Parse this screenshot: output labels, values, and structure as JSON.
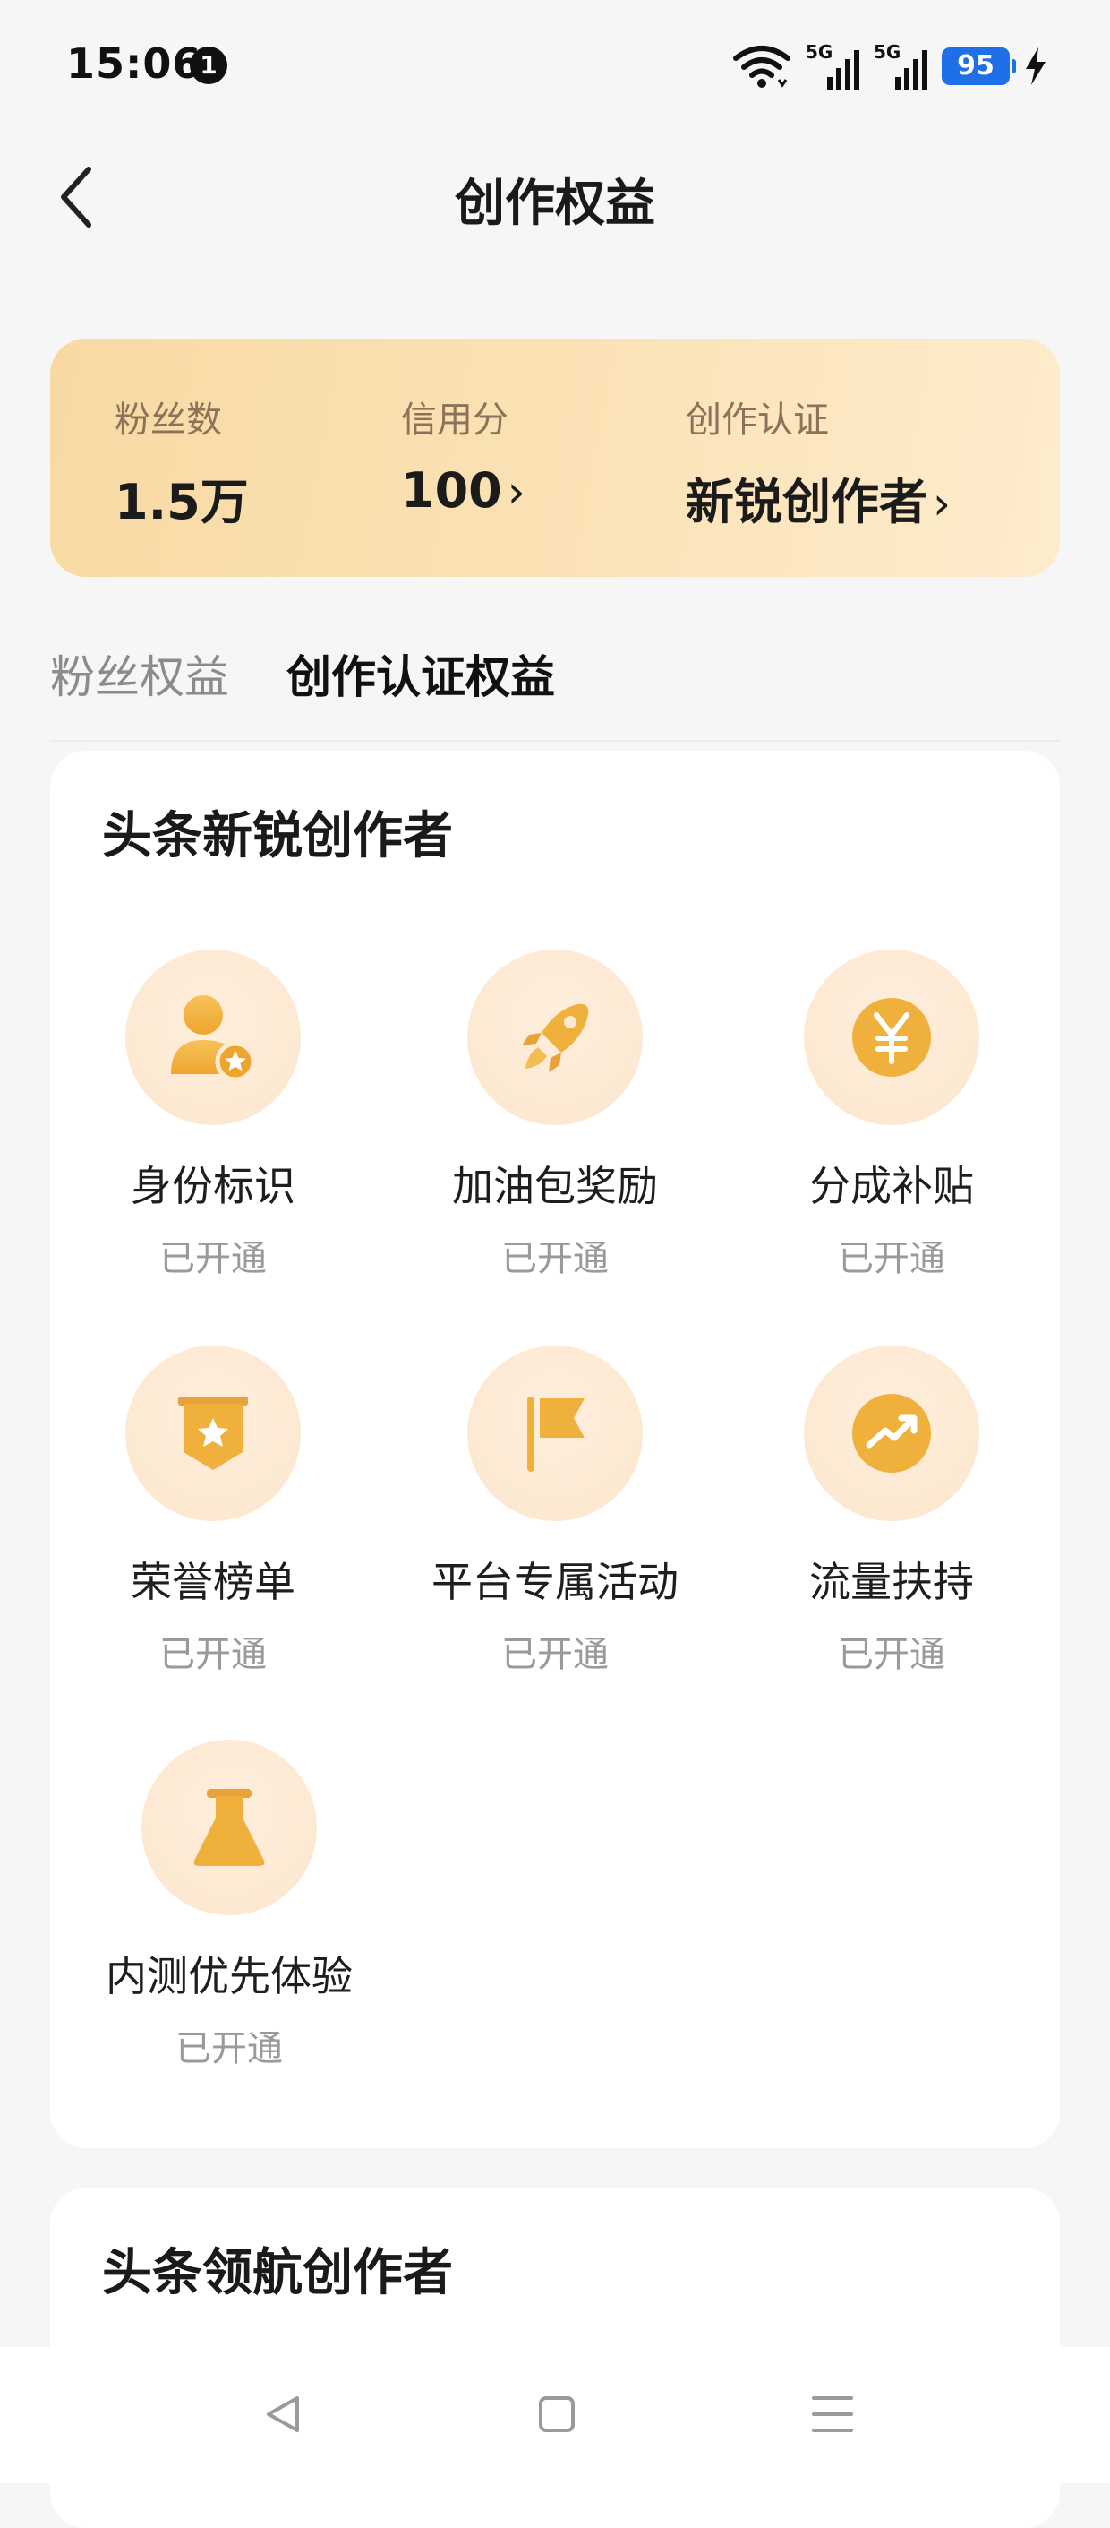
{
  "status_bar": {
    "time": "15:06",
    "notification_count": "1",
    "network_1": "5G",
    "network_2": "5G",
    "battery": "95"
  },
  "header": {
    "title": "创作权益"
  },
  "stats": {
    "fans": {
      "label": "粉丝数",
      "value": "1.5万"
    },
    "credit": {
      "label": "信用分",
      "value": "100"
    },
    "certification": {
      "label": "创作认证",
      "value": "新锐创作者"
    }
  },
  "tabs": [
    {
      "label": "粉丝权益",
      "active": false
    },
    {
      "label": "创作认证权益",
      "active": true
    }
  ],
  "section_1": {
    "title": "头条新锐创作者",
    "benefits": [
      {
        "label": "身份标识",
        "status": "已开通",
        "icon": "user-badge-icon"
      },
      {
        "label": "加油包奖励",
        "status": "已开通",
        "icon": "rocket-icon"
      },
      {
        "label": "分成补贴",
        "status": "已开通",
        "icon": "yuan-coin-icon"
      },
      {
        "label": "荣誉榜单",
        "status": "已开通",
        "icon": "star-shield-icon"
      },
      {
        "label": "平台专属活动",
        "status": "已开通",
        "icon": "flag-icon"
      },
      {
        "label": "流量扶持",
        "status": "已开通",
        "icon": "trend-up-icon"
      },
      {
        "label": "内测优先体验",
        "status": "已开通",
        "icon": "flask-icon"
      }
    ]
  },
  "section_2": {
    "title": "头条领航创作者"
  },
  "colors": {
    "accent": "#f0b03c",
    "icon_bg": "#fdebd4",
    "stats_bg": "#f8d9a3",
    "battery": "#1f6fe8"
  }
}
